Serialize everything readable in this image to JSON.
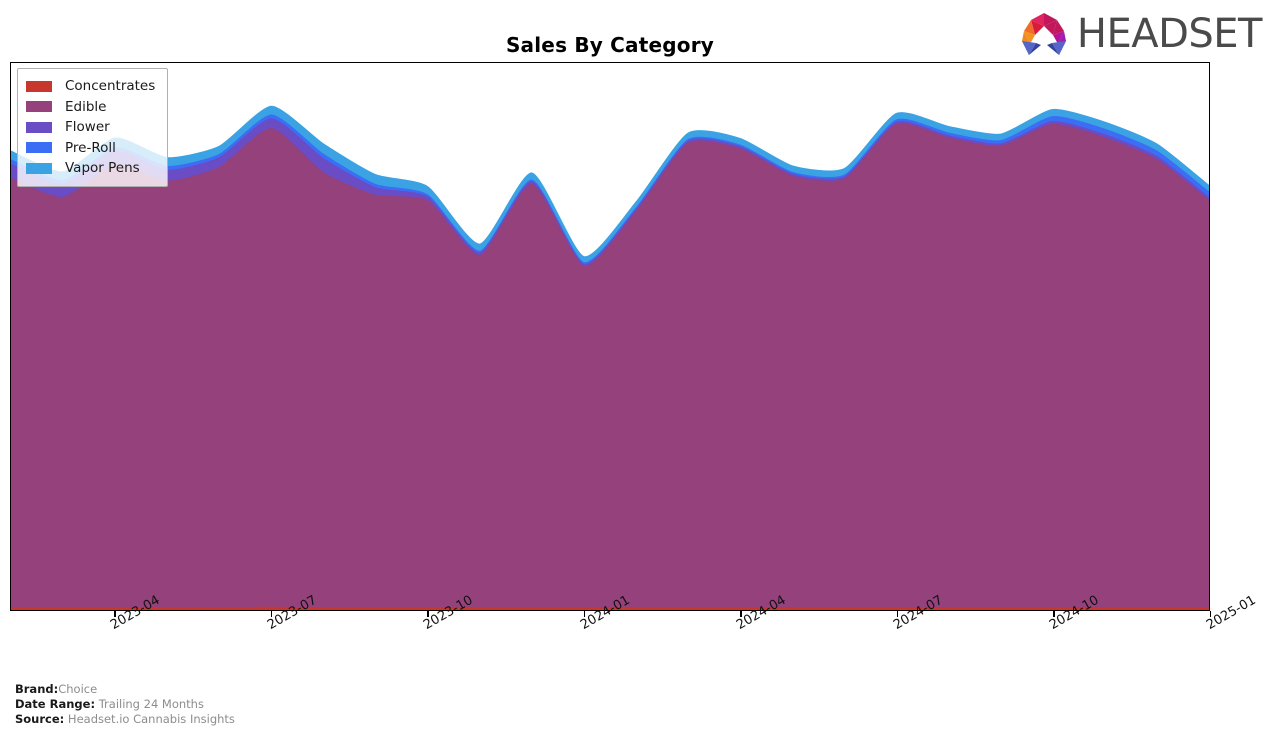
{
  "header": {
    "title": "Sales By Category",
    "logo_word": "HEADSET",
    "logo_icon": "headset-logo-icon"
  },
  "legend": {
    "position": "upper-left",
    "items": [
      {
        "label": "Concentrates",
        "color": "#c8372d"
      },
      {
        "label": "Edible",
        "color": "#94417c"
      },
      {
        "label": "Flower",
        "color": "#6a4cc4"
      },
      {
        "label": "Pre-Roll",
        "color": "#3b6ef5"
      },
      {
        "label": "Vapor Pens",
        "color": "#3ba3e3"
      }
    ]
  },
  "footer": {
    "rows": [
      {
        "key": "Brand:",
        "value": "Choice"
      },
      {
        "key": "Date Range:",
        "value": "Trailing 24 Months"
      },
      {
        "key": "Source:",
        "value": "Headset.io Cannabis Insights"
      }
    ]
  },
  "chart_data": {
    "type": "area",
    "stacked": true,
    "title": "Sales By Category",
    "xlabel": "",
    "ylabel": "",
    "grid": false,
    "legend_position": "upper-left",
    "ylim": [
      0,
      100
    ],
    "x_tick_labels": [
      "2023-04",
      "2023-07",
      "2023-10",
      "2024-01",
      "2024-04",
      "2024-07",
      "2024-10",
      "2025-01"
    ],
    "x": [
      "2023-02",
      "2023-03",
      "2023-04",
      "2023-05",
      "2023-06",
      "2023-07",
      "2023-08",
      "2023-09",
      "2023-10",
      "2023-11",
      "2023-12",
      "2024-01",
      "2024-02",
      "2024-03",
      "2024-04",
      "2024-05",
      "2024-06",
      "2024-07",
      "2024-08",
      "2024-09",
      "2024-10",
      "2024-11",
      "2024-12",
      "2025-01"
    ],
    "series": [
      {
        "name": "Concentrates",
        "color": "#c8372d",
        "values": [
          0.4,
          0.4,
          0.4,
          0.4,
          0.4,
          0.5,
          0.4,
          0.3,
          0.3,
          0.3,
          0.3,
          0.3,
          0.3,
          0.3,
          0.3,
          0.3,
          0.3,
          0.3,
          0.3,
          0.3,
          0.3,
          0.3,
          0.3,
          0.3
        ]
      },
      {
        "name": "Edible",
        "color": "#94417c",
        "values": [
          78.5,
          75.0,
          81.0,
          78.0,
          80.5,
          87.5,
          79.5,
          75.5,
          74.5,
          64.5,
          77.5,
          62.5,
          72.5,
          85.0,
          84.0,
          79.0,
          78.5,
          88.5,
          86.0,
          84.5,
          88.5,
          86.0,
          82.0,
          74.5
        ]
      },
      {
        "name": "Flower",
        "color": "#6a4cc4",
        "values": [
          2.6,
          2.4,
          2.4,
          2.0,
          1.8,
          1.8,
          2.6,
          1.4,
          0.7,
          0.5,
          0.5,
          0.4,
          0.4,
          0.4,
          0.4,
          0.4,
          0.4,
          0.4,
          0.4,
          0.4,
          0.5,
          0.6,
          0.6,
          0.6
        ]
      },
      {
        "name": "Pre-Roll",
        "color": "#3b6ef5",
        "values": [
          0.8,
          0.7,
          0.7,
          0.7,
          0.6,
          0.7,
          0.8,
          0.6,
          0.4,
          0.3,
          0.3,
          0.3,
          0.3,
          0.3,
          0.3,
          0.3,
          0.3,
          0.4,
          0.5,
          0.6,
          0.9,
          1.0,
          1.0,
          1.0
        ]
      },
      {
        "name": "Vapor Pens",
        "color": "#3ba3e3",
        "values": [
          1.6,
          1.6,
          1.8,
          1.6,
          1.5,
          1.6,
          1.9,
          1.8,
          1.5,
          1.3,
          1.3,
          1.1,
          1.1,
          1.2,
          1.2,
          1.2,
          1.2,
          1.2,
          1.2,
          1.2,
          1.3,
          1.3,
          1.3,
          1.2
        ]
      }
    ]
  }
}
